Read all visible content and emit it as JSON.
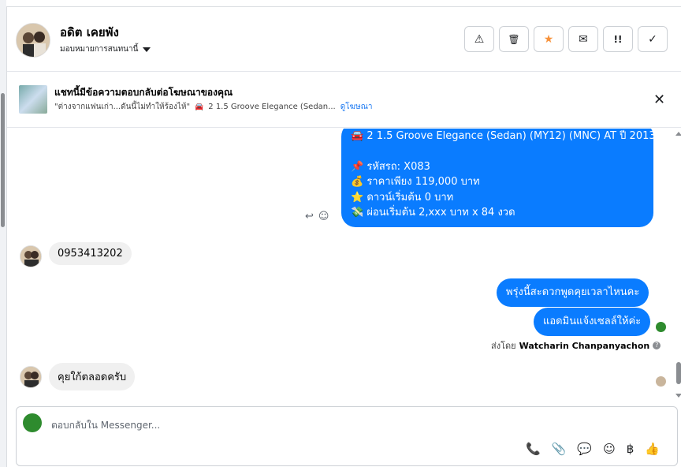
{
  "header": {
    "contact_name": "อดิต เคยพัง",
    "assign_label": "มอบหมายการสนทนานี้",
    "actions": [
      {
        "name": "report-spam-button",
        "icon": "warning-icon",
        "glyph": "⚠"
      },
      {
        "name": "delete-button",
        "icon": "trash-icon",
        "glyph": "🗑"
      },
      {
        "name": "star-button",
        "icon": "star-icon",
        "glyph": "★"
      },
      {
        "name": "mark-unread-button",
        "icon": "envelope-icon",
        "glyph": "✉"
      },
      {
        "name": "follow-up-button",
        "icon": "priority-icon",
        "glyph": "!!"
      },
      {
        "name": "mark-done-button",
        "icon": "check-icon",
        "glyph": "✓"
      }
    ]
  },
  "banner": {
    "title": "แชทนี้มีข้อความตอบกลับต่อโฆษณาของคุณ",
    "subtitle_quote": "\"ต่างจากแฟนเก่า...ดันนี้ไม่ทำให้ร้องไห้\"",
    "subtitle_car": "2 1.5 Groove Elegance (Sedan...",
    "link": "ดูโฆษณา",
    "close": "✕"
  },
  "messages": {
    "ad_message_lines": [
      "🚘 2 1.5 Groove Elegance (Sedan) (MY12) (MNC) AT ปี 2013",
      "",
      "📌 รหัสรถ: X083",
      "💰 ราคาเพียง 119,000 บาท",
      "⭐ ดาวน์เริ่มต้น 0 บาท",
      "💸 ผ่อนเริ่มต้น 2,xxx บาท x 84 งวด"
    ],
    "reply_icon": "↩",
    "emoji_icon": "☺",
    "incoming_1": "0953413202",
    "outgoing_1": "พรุ่งนี้สะดวกพูดคุยเวลาไหนคะ",
    "outgoing_2": "แอดมินแจ้งเซลล์ให้ค่ะ",
    "sent_by_prefix": "ส่งโดย",
    "sent_by_name": "Watcharin Chanpanyachon",
    "incoming_2": "คุยใก้ตลอดครับ"
  },
  "composer": {
    "placeholder": "ตอบกลับใน Messenger...",
    "tools": [
      {
        "name": "call-icon",
        "glyph": "📞"
      },
      {
        "name": "attachment-icon",
        "glyph": "📎"
      },
      {
        "name": "saved-reply-icon",
        "glyph": "💬"
      },
      {
        "name": "emoji-icon",
        "glyph": "☺"
      },
      {
        "name": "currency-icon",
        "glyph": "฿"
      },
      {
        "name": "like-icon",
        "glyph": "👍"
      }
    ]
  },
  "colors": {
    "outgoing_bubble": "#0a7cff",
    "incoming_bubble": "#f0f0f0",
    "star_accent": "#f7923b",
    "link": "#1877f2"
  }
}
